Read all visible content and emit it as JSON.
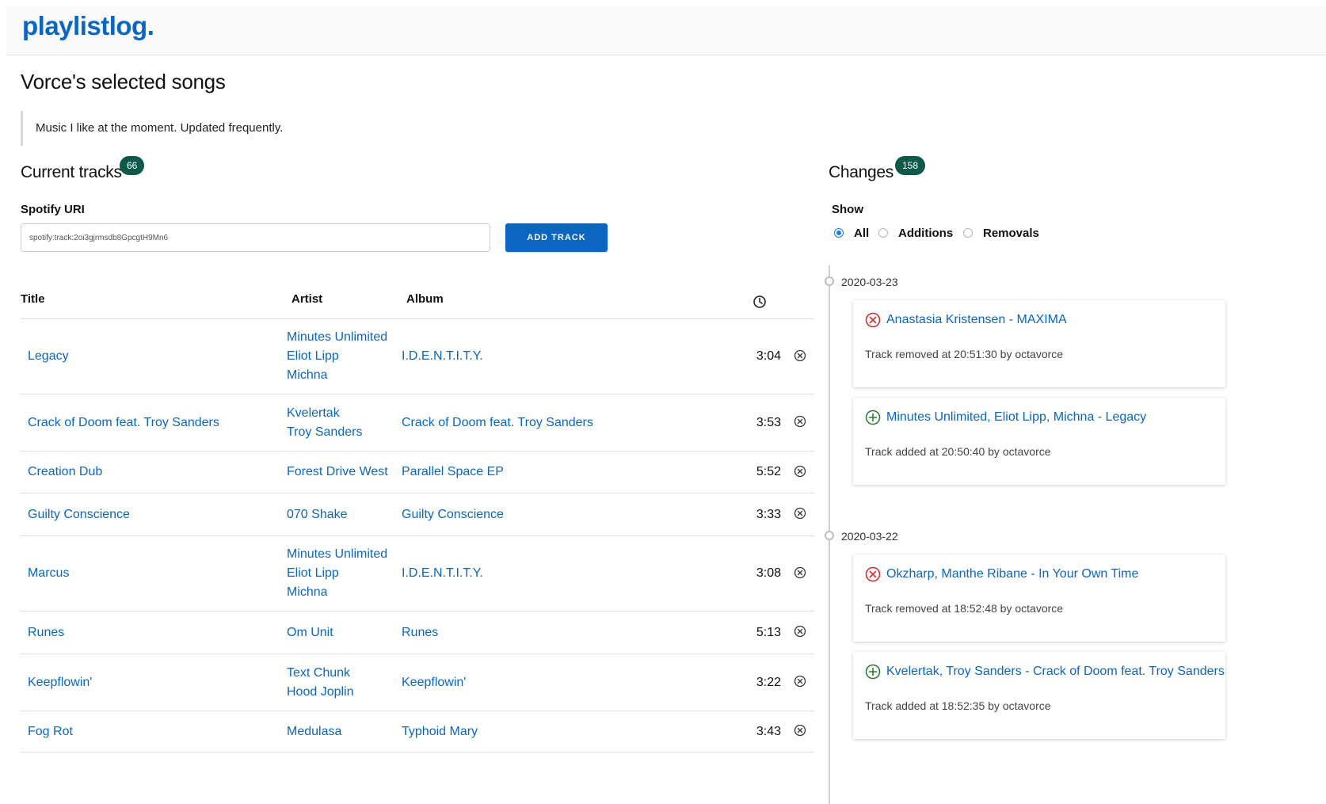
{
  "app": {
    "logo": "playlistlog."
  },
  "page": {
    "title": "Vorce's selected songs",
    "description": "Music I like at the moment. Updated frequently."
  },
  "tracks_section": {
    "title": "Current tracks",
    "count": "66",
    "uri_label": "Spotify URI",
    "uri_value": "spotify:track:2oi3gjrmsdb8GpcgtH9Mn6",
    "add_button": "ADD TRACK",
    "columns": {
      "title": "Title",
      "artist": "Artist",
      "album": "Album",
      "duration_icon": "clock-icon"
    },
    "rows": [
      {
        "title": "Legacy",
        "artists": [
          "Minutes Unlimited",
          "Eliot Lipp",
          "Michna"
        ],
        "album": "I.D.E.N.T.I.T.Y.",
        "duration": "3:04"
      },
      {
        "title": "Crack of Doom feat. Troy Sanders",
        "artists": [
          "Kvelertak",
          "Troy Sanders"
        ],
        "album": "Crack of Doom feat. Troy Sanders",
        "duration": "3:53"
      },
      {
        "title": "Creation Dub",
        "artists": [
          "Forest Drive West"
        ],
        "album": "Parallel Space EP",
        "duration": "5:52"
      },
      {
        "title": "Guilty Conscience",
        "artists": [
          "070 Shake"
        ],
        "album": "Guilty Conscience",
        "duration": "3:33"
      },
      {
        "title": "Marcus",
        "artists": [
          "Minutes Unlimited",
          "Eliot Lipp",
          "Michna"
        ],
        "album": "I.D.E.N.T.I.T.Y.",
        "duration": "3:08"
      },
      {
        "title": "Runes",
        "artists": [
          "Om Unit"
        ],
        "album": "Runes",
        "duration": "5:13"
      },
      {
        "title": "Keepflowin'",
        "artists": [
          "Text Chunk",
          "Hood Joplin"
        ],
        "album": "Keepflowin'",
        "duration": "3:22"
      },
      {
        "title": "Fog Rot",
        "artists": [
          "Medulasa"
        ],
        "album": "Typhoid Mary",
        "duration": "3:43"
      }
    ]
  },
  "changes_section": {
    "title": "Changes",
    "count": "158",
    "filter_label": "Show",
    "filters": [
      {
        "label": "All",
        "selected": true
      },
      {
        "label": "Additions",
        "selected": false
      },
      {
        "label": "Removals",
        "selected": false
      }
    ],
    "groups": [
      {
        "date": "2020-03-23",
        "items": [
          {
            "type": "removed",
            "title": "Anastasia Kristensen - MAXIMA",
            "meta": "Track removed at 20:51:30 by octavorce"
          },
          {
            "type": "added",
            "title": "Minutes Unlimited, Eliot Lipp, Michna - Legacy",
            "meta": "Track added at 20:50:40 by octavorce"
          }
        ]
      },
      {
        "date": "2020-03-22",
        "items": [
          {
            "type": "removed",
            "title": "Okzharp, Manthe Ribane - In Your Own Time",
            "meta": "Track removed at 18:52:48 by octavorce"
          },
          {
            "type": "added",
            "title": "Kvelertak, Troy Sanders - Crack of Doom feat. Troy Sanders",
            "meta": "Track added at 18:52:35 by octavorce"
          }
        ]
      }
    ]
  },
  "colors": {
    "link": "#0b66c2",
    "badge": "#0e5a4a",
    "removed": "#d32f2f",
    "added": "#2e7d32",
    "radio_selected": "#1e7be0"
  }
}
